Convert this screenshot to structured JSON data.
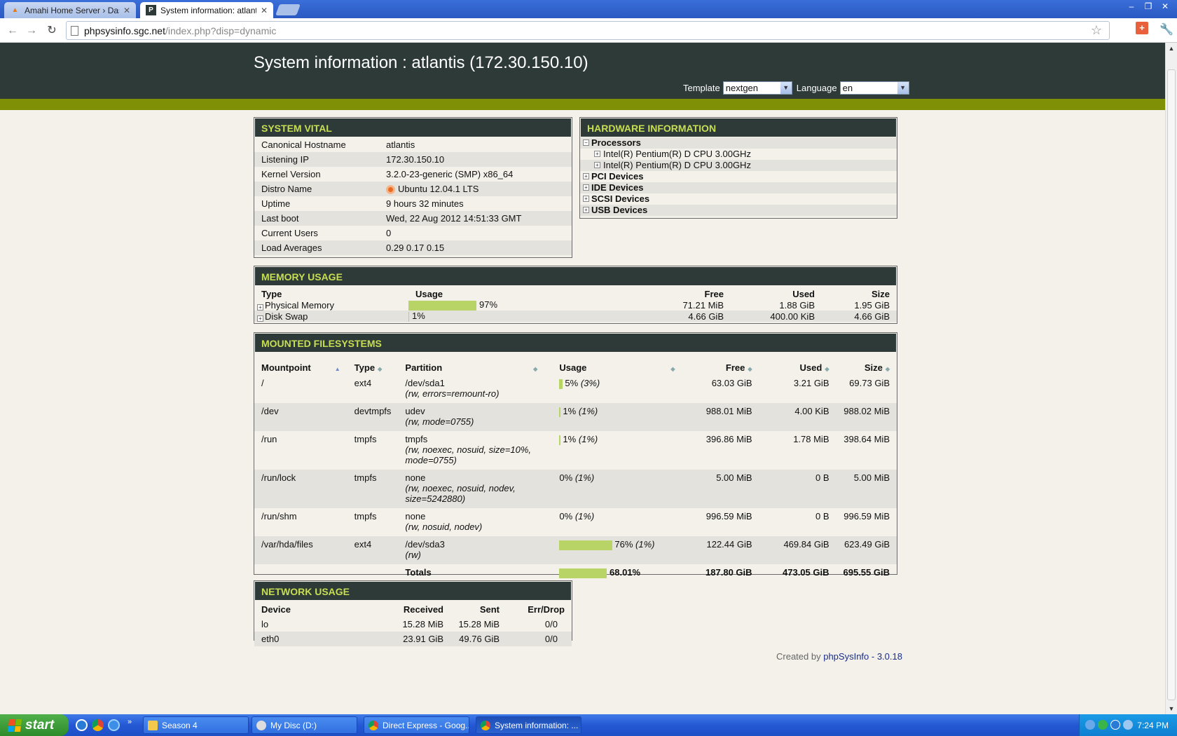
{
  "browser": {
    "tabs": [
      {
        "title": "Amahi Home Server › Dashbo",
        "active": false
      },
      {
        "title": "System information: atlantis (",
        "active": true
      }
    ],
    "url_host": "phpsysinfo.sgc.net",
    "url_path": "/index.php?disp=dynamic"
  },
  "header": {
    "title": "System information : atlantis (172.30.150.10)",
    "template_label": "Template",
    "template_value": "nextgen",
    "language_label": "Language",
    "language_value": "en"
  },
  "vital": {
    "title": "SYSTEM VITAL",
    "rows": [
      {
        "label": "Canonical Hostname",
        "value": "atlantis"
      },
      {
        "label": "Listening IP",
        "value": "172.30.150.10"
      },
      {
        "label": "Kernel Version",
        "value": "3.2.0-23-generic (SMP) x86_64"
      },
      {
        "label": "Distro Name",
        "value": "Ubuntu 12.04.1 LTS"
      },
      {
        "label": "Uptime",
        "value": "9 hours 32 minutes"
      },
      {
        "label": "Last boot",
        "value": "Wed, 22 Aug 2012 14:51:33 GMT"
      },
      {
        "label": "Current Users",
        "value": "0"
      },
      {
        "label": "Load Averages",
        "value": "0.29 0.17 0.15"
      }
    ]
  },
  "hardware": {
    "title": "HARDWARE INFORMATION",
    "processors_label": "Processors",
    "cpus": [
      "Intel(R) Pentium(R) D CPU 3.00GHz",
      "Intel(R) Pentium(R) D CPU 3.00GHz"
    ],
    "groups": [
      "PCI Devices",
      "IDE Devices",
      "SCSI Devices",
      "USB Devices"
    ]
  },
  "memory": {
    "title": "MEMORY USAGE",
    "headers": {
      "type": "Type",
      "usage": "Usage",
      "free": "Free",
      "used": "Used",
      "size": "Size"
    },
    "rows": [
      {
        "type": "Physical Memory",
        "percent": 97,
        "usage_text": "97%",
        "free": "71.21 MiB",
        "used": "1.88 GiB",
        "size": "1.95 GiB"
      },
      {
        "type": "Disk Swap",
        "percent": 1,
        "usage_text": "1%",
        "free": "4.66 GiB",
        "used": "400.00 KiB",
        "size": "4.66 GiB"
      }
    ]
  },
  "filesystems": {
    "title": "MOUNTED FILESYSTEMS",
    "headers": {
      "mount": "Mountpoint",
      "type": "Type",
      "partition": "Partition",
      "usage": "Usage",
      "free": "Free",
      "used": "Used",
      "size": "Size"
    },
    "rows": [
      {
        "mount": "/",
        "type": "ext4",
        "partition": "/dev/sda1",
        "options": "(rw, errors=remount-ro)",
        "percent": 5,
        "usage_pct": "5%",
        "usage_inode": "(3%)",
        "free": "63.03 GiB",
        "used": "3.21 GiB",
        "size": "69.73 GiB"
      },
      {
        "mount": "/dev",
        "type": "devtmpfs",
        "partition": "udev",
        "options": "(rw, mode=0755)",
        "percent": 1,
        "usage_pct": "1%",
        "usage_inode": "(1%)",
        "free": "988.01 MiB",
        "used": "4.00 KiB",
        "size": "988.02 MiB"
      },
      {
        "mount": "/run",
        "type": "tmpfs",
        "partition": "tmpfs",
        "options": "(rw, noexec, nosuid, size=10%, mode=0755)",
        "percent": 1,
        "usage_pct": "1%",
        "usage_inode": "(1%)",
        "free": "396.86 MiB",
        "used": "1.78 MiB",
        "size": "398.64 MiB"
      },
      {
        "mount": "/run/lock",
        "type": "tmpfs",
        "partition": "none",
        "options": "(rw, noexec, nosuid, nodev, size=5242880)",
        "percent": 0,
        "usage_pct": "0%",
        "usage_inode": "(1%)",
        "free": "5.00 MiB",
        "used": "0 B",
        "size": "5.00 MiB"
      },
      {
        "mount": "/run/shm",
        "type": "tmpfs",
        "partition": "none",
        "options": "(rw, nosuid, nodev)",
        "percent": 0,
        "usage_pct": "0%",
        "usage_inode": "(1%)",
        "free": "996.59 MiB",
        "used": "0 B",
        "size": "996.59 MiB"
      },
      {
        "mount": "/var/hda/files",
        "type": "ext4",
        "partition": "/dev/sda3",
        "options": "(rw)",
        "percent": 76,
        "usage_pct": "76%",
        "usage_inode": "(1%)",
        "free": "122.44 GiB",
        "used": "469.84 GiB",
        "size": "623.49 GiB"
      }
    ],
    "totals": {
      "label": "Totals",
      "percent": 68.01,
      "usage_text": "68.01%",
      "free": "187.80 GiB",
      "used": "473.05 GiB",
      "size": "695.55 GiB"
    }
  },
  "network": {
    "title": "NETWORK USAGE",
    "headers": {
      "device": "Device",
      "received": "Received",
      "sent": "Sent",
      "errdrop": "Err/Drop"
    },
    "rows": [
      {
        "device": "lo",
        "received": "15.28 MiB",
        "sent": "15.28 MiB",
        "errdrop": "0/0"
      },
      {
        "device": "eth0",
        "received": "23.91 GiB",
        "sent": "49.76 GiB",
        "errdrop": "0/0"
      }
    ]
  },
  "footer": {
    "prefix": "Created by",
    "link": "phpSysInfo - 3.0.18"
  },
  "taskbar": {
    "start_label": "start",
    "tasks": [
      "Season 4",
      "My Disc (D:)",
      "Direct Express - Goog...",
      "System information: ..."
    ],
    "clock": "7:24 PM"
  }
}
